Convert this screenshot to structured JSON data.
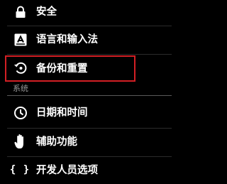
{
  "settings": {
    "security_label": "安全",
    "language_label": "语言和输入法",
    "backup_label": "备份和重置",
    "system_header": "系统",
    "datetime_label": "日期和时间",
    "accessibility_label": "辅助功能",
    "developer_label": "开发人员选项"
  },
  "icons": {
    "security": "lock-icon",
    "language": "keyboard-a-icon",
    "backup": "backup-restore-icon",
    "datetime": "clock-icon",
    "accessibility": "hand-icon",
    "developer": "braces-icon"
  },
  "colors": {
    "background": "#000000",
    "text": "#ffffff",
    "section_header": "#9a9a9a",
    "highlight": "#d21f24"
  }
}
